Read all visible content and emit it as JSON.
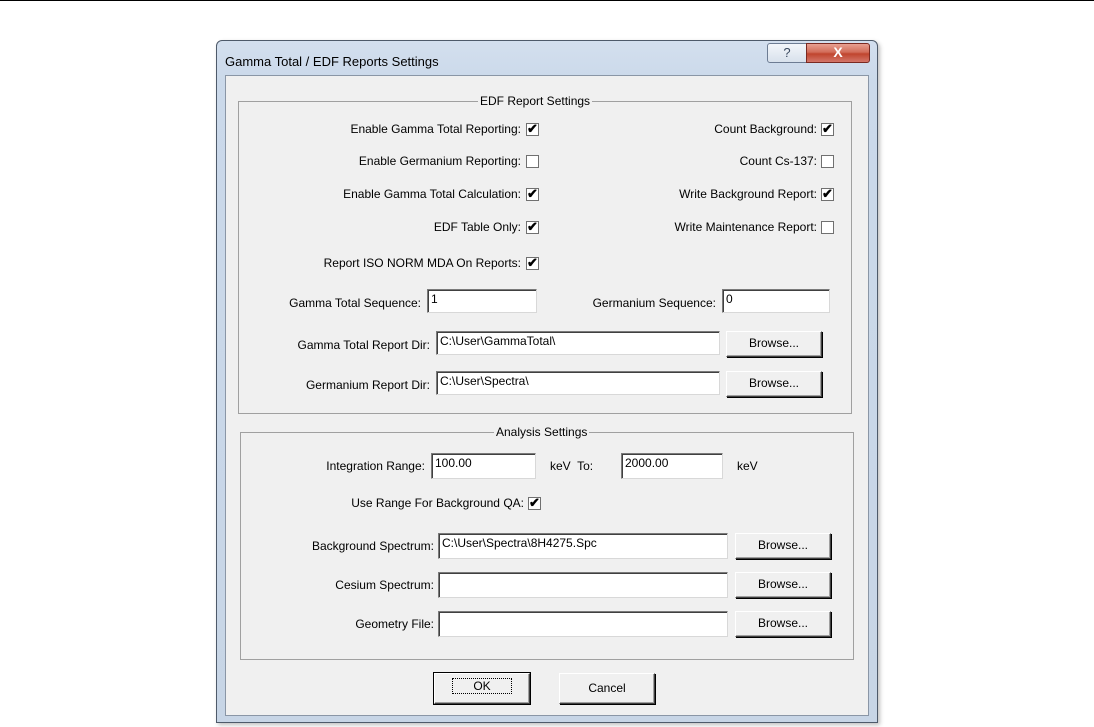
{
  "window": {
    "title": "Gamma Total / EDF Reports Settings",
    "help_glyph": "?",
    "close_glyph": "X"
  },
  "edf": {
    "legend": "EDF Report Settings",
    "enable_gamma_total_reporting": {
      "label": "Enable Gamma Total Reporting:",
      "checked": true
    },
    "enable_germanium_reporting": {
      "label": "Enable Germanium Reporting:",
      "checked": false
    },
    "enable_gamma_total_calculation": {
      "label": "Enable Gamma Total Calculation:",
      "checked": true
    },
    "edf_table_only": {
      "label": "EDF Table Only:",
      "checked": true
    },
    "report_iso_norm_mda": {
      "label": "Report ISO NORM MDA On Reports:",
      "checked": true
    },
    "count_background": {
      "label": "Count Background:",
      "checked": true
    },
    "count_cs137": {
      "label": "Count Cs-137:",
      "checked": false
    },
    "write_background_report": {
      "label": "Write Background Report:",
      "checked": true
    },
    "write_maintenance_report": {
      "label": "Write Maintenance Report:",
      "checked": false
    },
    "gamma_total_sequence": {
      "label": "Gamma Total Sequence:",
      "value": "1"
    },
    "germanium_sequence": {
      "label": "Germanium Sequence:",
      "value": "0"
    },
    "gamma_total_report_dir": {
      "label": "Gamma Total Report Dir:",
      "value": "C:\\User\\GammaTotal\\"
    },
    "germanium_report_dir": {
      "label": "Germanium Report Dir:",
      "value": "C:\\User\\Spectra\\"
    },
    "browse_label": "Browse..."
  },
  "analysis": {
    "legend": "Analysis Settings",
    "integration_range_label": "Integration Range:",
    "range_from": "100.00",
    "kev_to_label": "keV  To:",
    "range_to": "2000.00",
    "kev_label": "keV",
    "use_range_bg_qa": {
      "label": "Use Range For Background QA:",
      "checked": true
    },
    "background_spectrum": {
      "label": "Background Spectrum:",
      "value": "C:\\User\\Spectra\\8H4275.Spc"
    },
    "cesium_spectrum": {
      "label": "Cesium Spectrum:",
      "value": ""
    },
    "geometry_file": {
      "label": "Geometry File:",
      "value": ""
    },
    "browse_label": "Browse..."
  },
  "buttons": {
    "ok": "OK",
    "cancel": "Cancel"
  }
}
